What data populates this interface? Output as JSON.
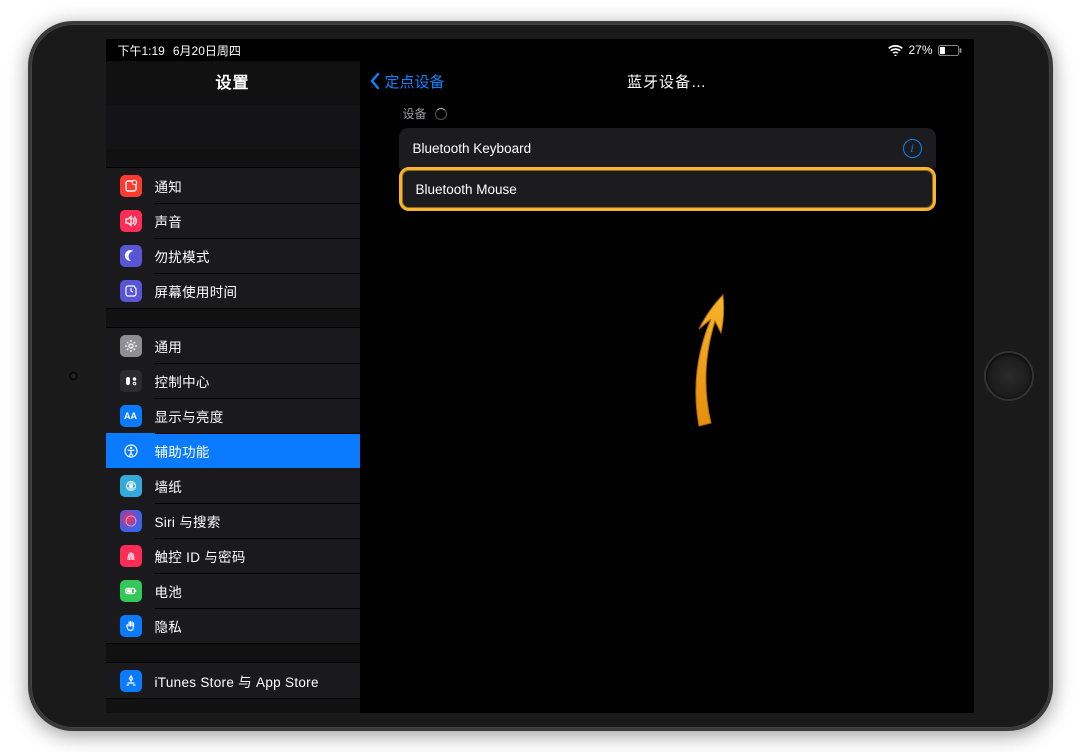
{
  "status": {
    "time": "下午1:19",
    "date": "6月20日周四",
    "battery": "27%"
  },
  "sidebar": {
    "title": "设置",
    "group1": [
      {
        "label": "通知"
      },
      {
        "label": "声音"
      },
      {
        "label": "勿扰模式"
      },
      {
        "label": "屏幕使用时间"
      }
    ],
    "group2": [
      {
        "label": "通用"
      },
      {
        "label": "控制中心"
      },
      {
        "label": "显示与亮度"
      },
      {
        "label": "辅助功能"
      },
      {
        "label": "墙纸"
      },
      {
        "label": "Siri 与搜索"
      },
      {
        "label": "触控 ID 与密码"
      },
      {
        "label": "电池"
      },
      {
        "label": "隐私"
      }
    ],
    "group3": [
      {
        "label": "iTunes Store 与 App Store"
      }
    ]
  },
  "detail": {
    "back_label": "定点设备",
    "title": "蓝牙设备…",
    "section_header": "设备",
    "devices": [
      {
        "label": "Bluetooth Keyboard"
      },
      {
        "label": "Bluetooth Mouse"
      }
    ]
  }
}
